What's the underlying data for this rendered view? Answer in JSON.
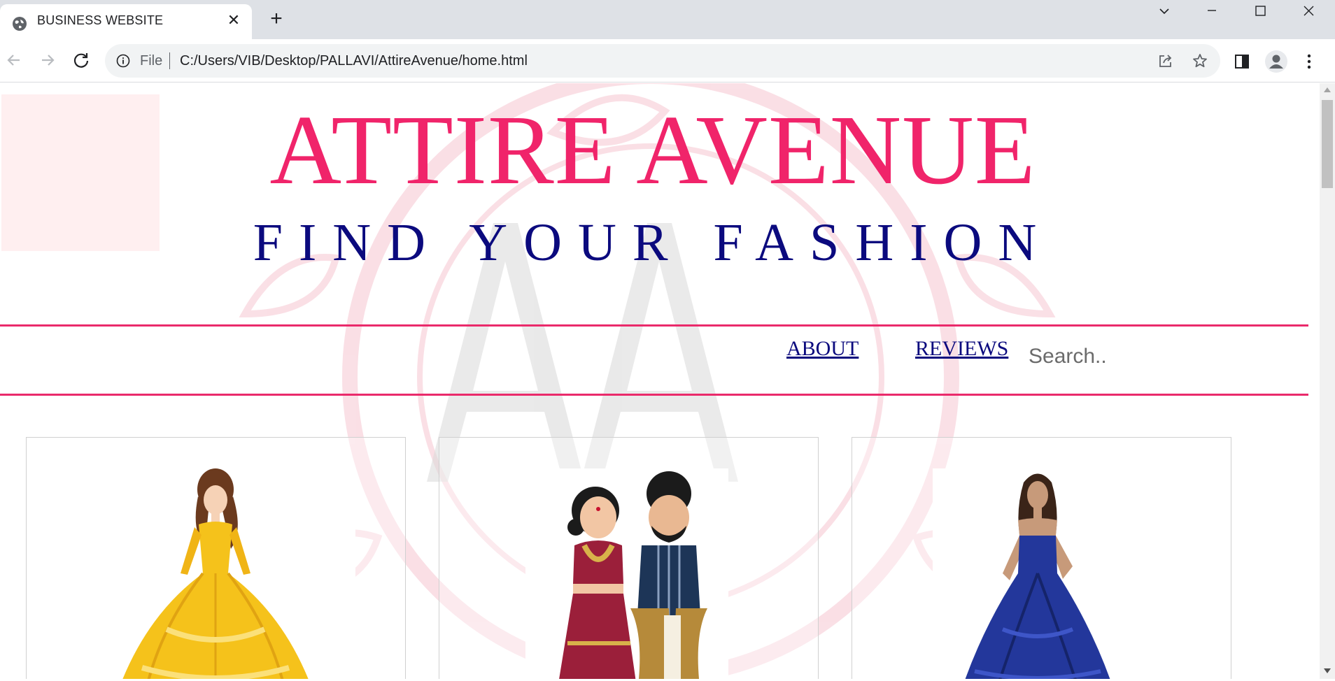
{
  "browser": {
    "tab_title": "BUSINESS WEBSITE",
    "address_prefix": "File",
    "url": "C:/Users/VIB/Desktop/PALLAVI/AttireAvenue/home.html"
  },
  "page": {
    "title": "ATTIRE AVENUE",
    "tagline": "FIND YOUR FASHION",
    "nav": {
      "about": "ABOUT",
      "reviews": "REVIEWS"
    },
    "search": {
      "placeholder": "Search.."
    },
    "products": [
      {
        "icon": "yellow-ball-gown-princess-illustration"
      },
      {
        "icon": "indian-wedding-couple-illustration"
      },
      {
        "icon": "blue-strapless-gown-illustration"
      }
    ]
  },
  "colors": {
    "title": "#f0246a",
    "tagline": "#0b0a7e",
    "nav_line": "#ea2a6b",
    "nav_link": "#0b0a7e"
  }
}
